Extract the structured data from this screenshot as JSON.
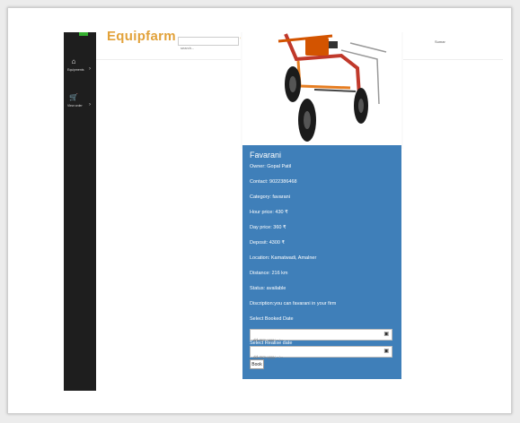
{
  "brand": "Equipfarm",
  "search": {
    "placeholder": "search..."
  },
  "user": {
    "name": "Sumar"
  },
  "sidebar": {
    "items": [
      {
        "label": "Equipments",
        "icon": "home-icon"
      },
      {
        "label": "View order",
        "icon": "cart-icon"
      }
    ]
  },
  "equipment": {
    "name": "Favarani",
    "owner": "Owner: Gopal Patil",
    "contact": "Contact: 9022386468",
    "category": "Category: favarani",
    "hour_price": "Hour price: 430 ₹",
    "day_price": "Day price: 360 ₹",
    "deposit": "Deposit: 4300 ₹",
    "location": "Location: Kamatwadi, Amalner",
    "distance": "Distance: 216 km",
    "status": "Status: available",
    "description": "Discription:you can favarani in your firm",
    "booked_date_label": "Select Booked Date",
    "release_date_label": "Select Realise date",
    "date_placeholder": "dd-mm-yyyy --:--",
    "book_label": "Book"
  },
  "colors": {
    "sidebar": "#1e1e1e",
    "accent": "#e2a23a",
    "card": "#3f7fb9"
  }
}
